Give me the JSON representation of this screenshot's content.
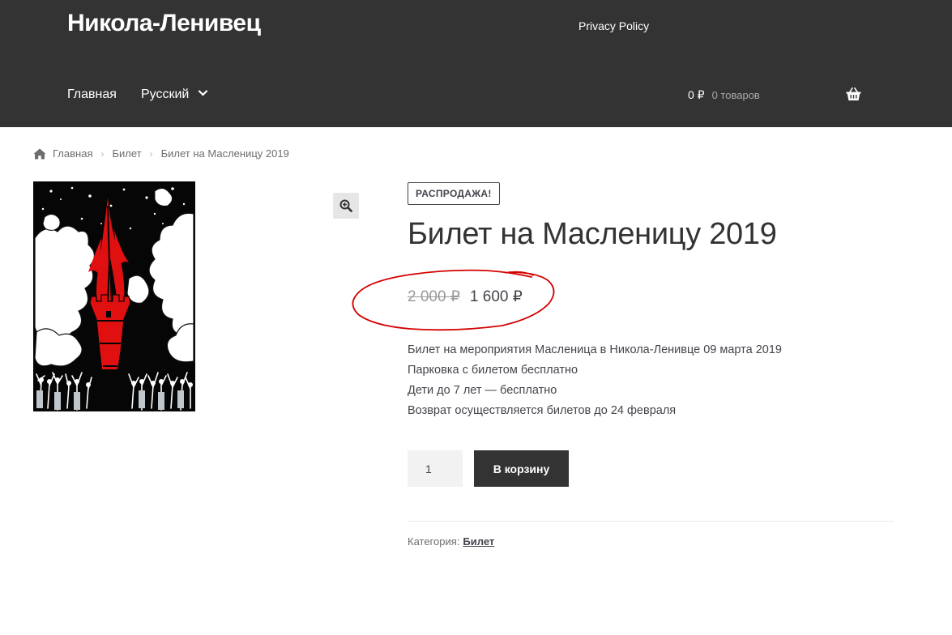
{
  "header": {
    "site_title": "Никола-Ленивец",
    "privacy_link": "Privacy Policy",
    "nav": {
      "home": "Главная",
      "language": "Русский"
    },
    "cart": {
      "amount": "0 ₽",
      "count": "0 товаров"
    }
  },
  "breadcrumb": {
    "home": "Главная",
    "category": "Билет",
    "current": "Билет на Масленицу 2019"
  },
  "product": {
    "sale_badge": "РАСПРОДАЖА!",
    "title": "Билет на Масленицу 2019",
    "price_old": "2 000 ₽",
    "price_new": "1 600 ₽",
    "description": [
      "Билет на мероприятия Масленица в Никола-Ленивце 09 марта 2019",
      "Парковка с билетом бесплатно",
      "Дети до 7 лет — бесплатно",
      "Возврат осуществляется билетов до 24 февраля"
    ],
    "quantity": "1",
    "add_to_cart": "В корзину",
    "category_label": "Категория:",
    "category_value": "Билет"
  },
  "colors": {
    "header_bg": "#333333",
    "annotation_red": "#d40000",
    "poster_red": "#e01010"
  },
  "icons": [
    "home-icon",
    "chevron-down-icon",
    "basket-icon",
    "zoom-icon"
  ]
}
